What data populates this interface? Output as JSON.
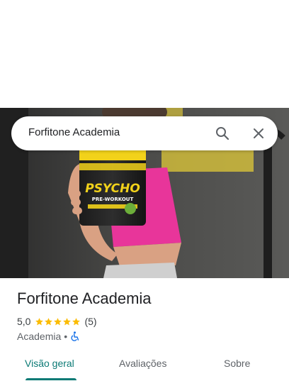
{
  "search": {
    "query": "Forfitone Academia",
    "icons": {
      "search": "search-icon",
      "close": "close-icon"
    }
  },
  "place": {
    "name": "Forfitone Academia",
    "rating": "5,0",
    "stars": 5,
    "review_count": "(5)",
    "category": "Academia",
    "separator": "•",
    "accessibility_icon": "wheelchair-accessible-icon"
  },
  "photo": {
    "product_label": "PSYCHO",
    "product_sublabel": "PRE-WORKOUT"
  },
  "tabs": [
    {
      "label": "Visão geral",
      "active": true
    },
    {
      "label": "Avaliações",
      "active": false
    },
    {
      "label": "Sobre",
      "active": false
    }
  ],
  "colors": {
    "accent": "#0b7a75",
    "star": "#fbbc04",
    "accessibility": "#1a73e8",
    "shirt": "#e8359a"
  }
}
